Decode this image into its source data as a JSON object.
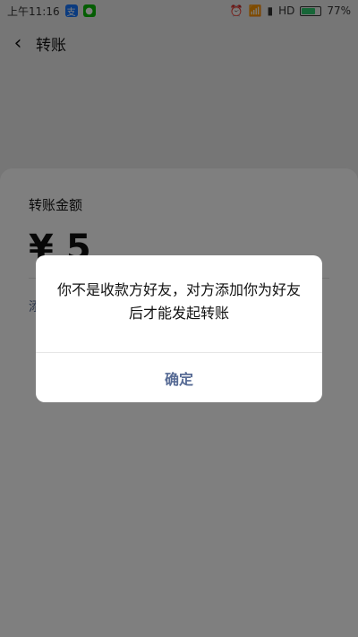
{
  "status_bar": {
    "time": "上午11:16",
    "network_label": "HD",
    "battery_percent": "77%",
    "battery_level": 0.77
  },
  "header": {
    "title": "转账"
  },
  "card": {
    "amount_label": "转账金额",
    "currency_symbol": "¥",
    "amount_value": "5",
    "remark_partial": "添"
  },
  "dialog": {
    "message": "你不是收款方好友，对方添加你为好友后才能发起转账",
    "confirm_label": "确定"
  },
  "colors": {
    "link_blue": "#576b95",
    "overlay": "rgba(0,0,0,0.5)"
  }
}
